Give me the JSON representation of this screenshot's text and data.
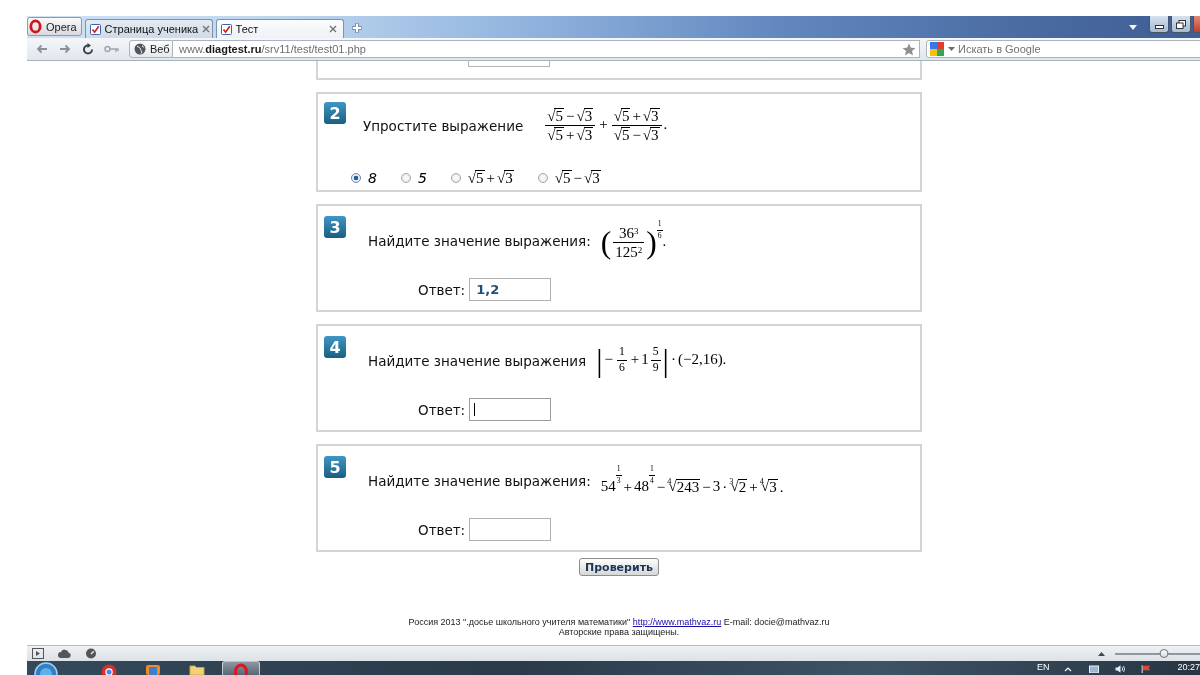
{
  "browser": {
    "menu_button": "Opera",
    "tabs": [
      {
        "title": "Страница ученика",
        "selected": false
      },
      {
        "title": "Тест",
        "selected": true
      }
    ],
    "address": {
      "mode_button": "Веб",
      "url": "www.**diagtest.ru**/srv11/test/test01.php"
    },
    "search": {
      "placeholder": "Искать в Google"
    }
  },
  "questions": [
    {
      "number": "2",
      "kind": "choice",
      "prompt": "Упростите выражение",
      "formula": [
        {
          "kind": "frac",
          "num": [
            {
              "kind": "root",
              "sign": "√",
              "body": [
                {
                  "kind": "text",
                  "text": "5"
                }
              ]
            },
            {
              "kind": "op",
              "text": "−"
            },
            {
              "kind": "root",
              "sign": "√",
              "body": [
                {
                  "kind": "text",
                  "text": "3"
                }
              ]
            }
          ],
          "den": [
            {
              "kind": "root",
              "sign": "√",
              "body": [
                {
                  "kind": "text",
                  "text": "5"
                }
              ]
            },
            {
              "kind": "op",
              "text": "+"
            },
            {
              "kind": "root",
              "sign": "√",
              "body": [
                {
                  "kind": "text",
                  "text": "3"
                }
              ]
            }
          ]
        },
        {
          "kind": "op",
          "text": "+"
        },
        {
          "kind": "frac",
          "num": [
            {
              "kind": "root",
              "sign": "√",
              "body": [
                {
                  "kind": "text",
                  "text": "5"
                }
              ]
            },
            {
              "kind": "op",
              "text": "+"
            },
            {
              "kind": "root",
              "sign": "√",
              "body": [
                {
                  "kind": "text",
                  "text": "3"
                }
              ]
            }
          ],
          "den": [
            {
              "kind": "root",
              "sign": "√",
              "body": [
                {
                  "kind": "text",
                  "text": "5"
                }
              ]
            },
            {
              "kind": "op",
              "text": "−"
            },
            {
              "kind": "root",
              "sign": "√",
              "body": [
                {
                  "kind": "text",
                  "text": "3"
                }
              ]
            }
          ]
        },
        {
          "kind": "text",
          "text": "."
        }
      ],
      "options": [
        {
          "selected": true,
          "label": [
            {
              "kind": "num",
              "text": "8"
            }
          ]
        },
        {
          "selected": false,
          "label": [
            {
              "kind": "num",
              "text": "5"
            }
          ]
        },
        {
          "selected": false,
          "label": [
            {
              "kind": "root",
              "sign": "√",
              "body": [
                {
                  "kind": "text",
                  "text": "5"
                }
              ]
            },
            {
              "kind": "op",
              "text": "+"
            },
            {
              "kind": "root",
              "sign": "√",
              "body": [
                {
                  "kind": "text",
                  "text": "3"
                }
              ]
            }
          ]
        },
        {
          "selected": false,
          "label": [
            {
              "kind": "root",
              "sign": "√",
              "body": [
                {
                  "kind": "text",
                  "text": "5"
                }
              ]
            },
            {
              "kind": "op",
              "text": "−"
            },
            {
              "kind": "root",
              "sign": "√",
              "body": [
                {
                  "kind": "text",
                  "text": "3"
                }
              ]
            }
          ]
        }
      ]
    },
    {
      "number": "3",
      "kind": "answer",
      "prompt": "Найдите значение выражения:",
      "formula": [
        {
          "kind": "delim",
          "text": "("
        },
        {
          "kind": "frac",
          "num": [
            {
              "kind": "text",
              "text": "36"
            },
            {
              "kind": "sup",
              "body": [
                {
                  "kind": "text",
                  "text": "3"
                }
              ]
            }
          ],
          "den": [
            {
              "kind": "text",
              "text": "125"
            },
            {
              "kind": "sup",
              "body": [
                {
                  "kind": "text",
                  "text": "2"
                }
              ]
            }
          ]
        },
        {
          "kind": "delim",
          "text": ")"
        },
        {
          "kind": "sup",
          "body": [
            {
              "kind": "frac",
              "num": [
                {
                  "kind": "text",
                  "text": "1"
                }
              ],
              "den": [
                {
                  "kind": "text",
                  "text": "6"
                }
              ]
            }
          ]
        },
        {
          "kind": "text",
          "text": "."
        }
      ],
      "answer": {
        "label": "Ответ:",
        "value": "1,2",
        "focused": false
      }
    },
    {
      "number": "4",
      "kind": "answer",
      "prompt": "Найдите значение выражения",
      "formula": [
        {
          "kind": "delim",
          "text": "|"
        },
        {
          "kind": "op",
          "text": "−"
        },
        {
          "kind": "frac",
          "num": [
            {
              "kind": "text",
              "text": "1"
            }
          ],
          "den": [
            {
              "kind": "text",
              "text": "6"
            }
          ]
        },
        {
          "kind": "op",
          "text": "+"
        },
        {
          "kind": "text",
          "text": "1"
        },
        {
          "kind": "frac",
          "num": [
            {
              "kind": "text",
              "text": "5"
            }
          ],
          "den": [
            {
              "kind": "text",
              "text": "9"
            }
          ]
        },
        {
          "kind": "delim",
          "text": "|"
        },
        {
          "kind": "op",
          "text": "·"
        },
        {
          "kind": "text",
          "text": "(−2,16)."
        }
      ],
      "answer": {
        "label": "Ответ:",
        "focused": true
      }
    },
    {
      "number": "5",
      "kind": "answer",
      "prompt": "Найдите значение выражения:",
      "formula": [
        {
          "kind": "text",
          "text": "54"
        },
        {
          "kind": "sup",
          "body": [
            {
              "kind": "frac",
              "num": [
                {
                  "kind": "text",
                  "text": "1"
                }
              ],
              "den": [
                {
                  "kind": "text",
                  "text": "3"
                }
              ]
            }
          ]
        },
        {
          "kind": "op",
          "text": "+"
        },
        {
          "kind": "text",
          "text": "48"
        },
        {
          "kind": "sup",
          "body": [
            {
              "kind": "frac",
              "num": [
                {
                  "kind": "text",
                  "text": "1"
                }
              ],
              "den": [
                {
                  "kind": "text",
                  "text": "4"
                }
              ]
            }
          ]
        },
        {
          "kind": "op",
          "text": "−"
        },
        {
          "kind": "root",
          "index": "4",
          "sign": "√",
          "body": [
            {
              "kind": "text",
              "text": "243"
            }
          ]
        },
        {
          "kind": "op",
          "text": "−"
        },
        {
          "kind": "text",
          "text": "3"
        },
        {
          "kind": "op",
          "text": "·"
        },
        {
          "kind": "root",
          "index": "3",
          "sign": "√",
          "body": [
            {
              "kind": "text",
              "text": "2"
            }
          ]
        },
        {
          "kind": "op",
          "text": "+"
        },
        {
          "kind": "root",
          "index": "4",
          "sign": "√",
          "body": [
            {
              "kind": "text",
              "text": "3"
            }
          ]
        },
        {
          "kind": "op",
          "text": "."
        }
      ],
      "answer": {
        "label": "Ответ:",
        "focused": false
      }
    }
  ],
  "submit_button": "Проверить",
  "footer": {
    "before": "Россия 2013 \".досье школьного учителя математики\"",
    "link": "http://www.mathvaz.ru",
    "after": "E-mail: docie@mathvaz.ru",
    "rights": "Авторские права защищены."
  },
  "status_bar": {
    "zoom_slider": {
      "level": 0.5
    }
  },
  "taskbar": {
    "apps": [
      {
        "active": false
      },
      {
        "active": false
      },
      {
        "active": false
      },
      {
        "active": true
      }
    ],
    "language": "EN",
    "clock": "20:27"
  }
}
